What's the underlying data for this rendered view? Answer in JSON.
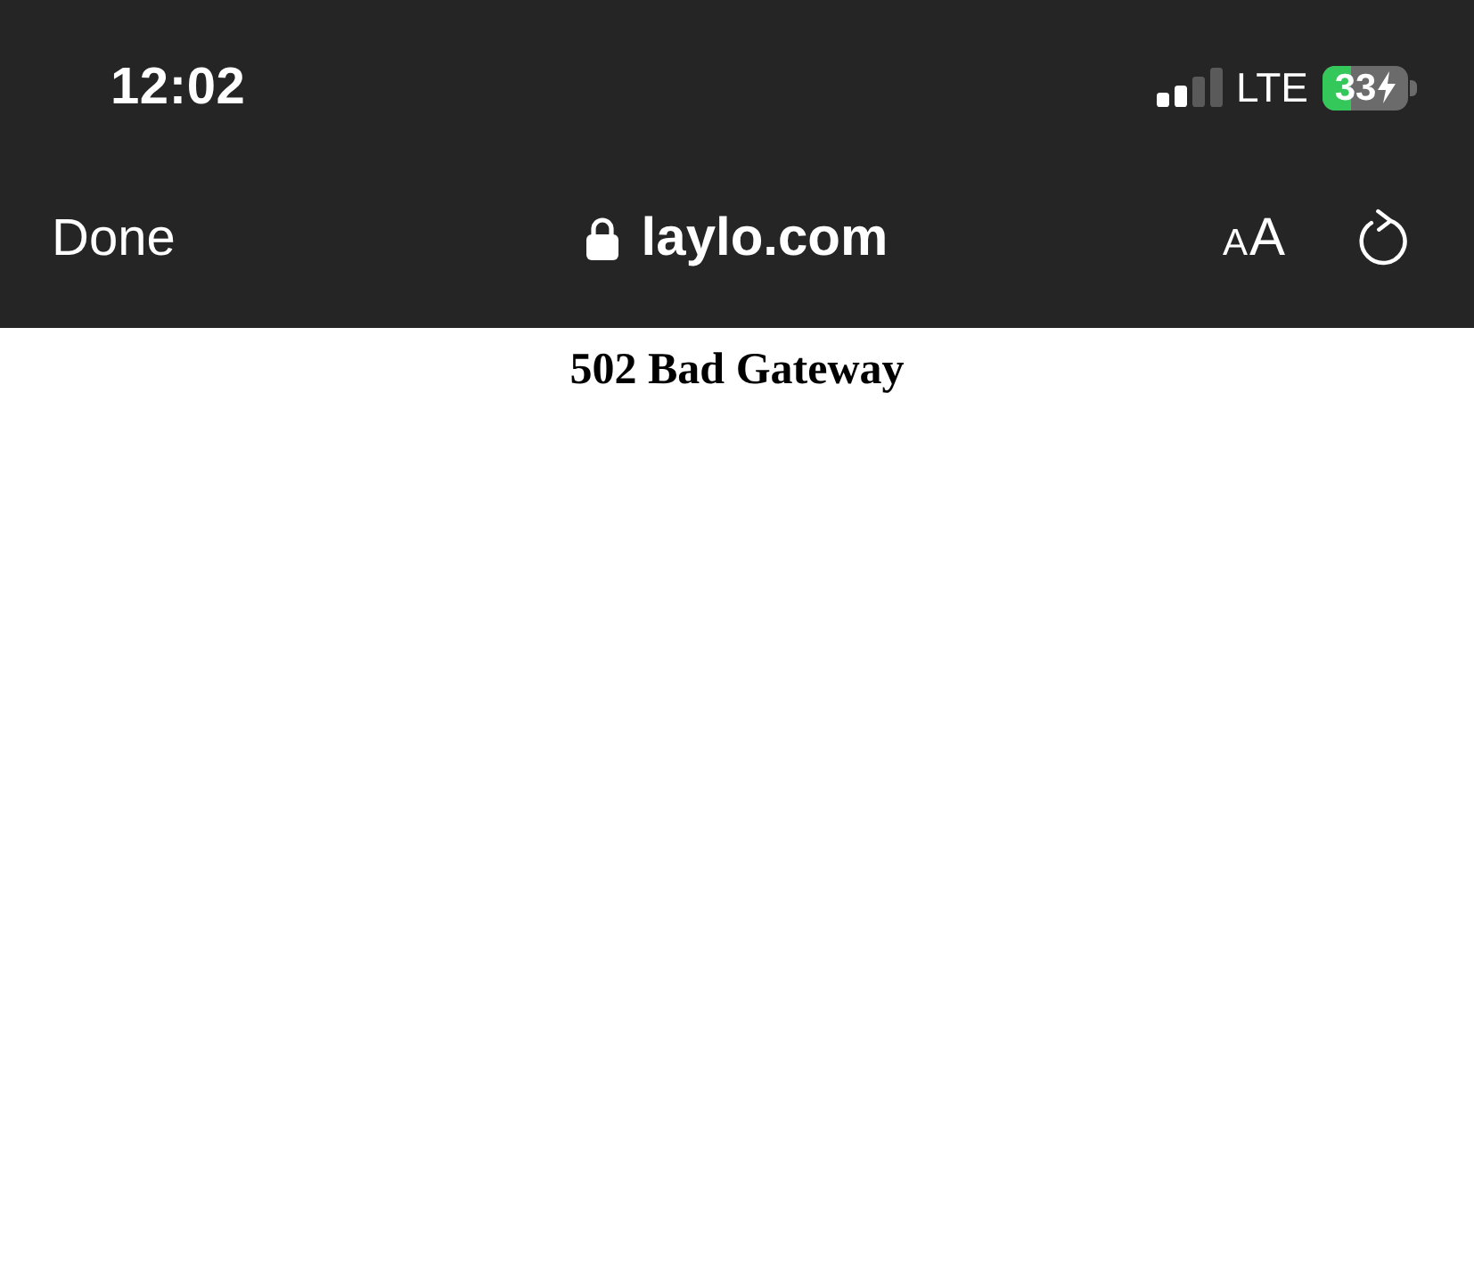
{
  "status_bar": {
    "time": "12:02",
    "network": "LTE",
    "battery": {
      "percent": "33",
      "charging": true
    }
  },
  "browser_bar": {
    "done_button": "Done",
    "address": {
      "secure": true,
      "domain": "laylo.com"
    },
    "text_size_button": [
      "A",
      "A"
    ]
  },
  "page": {
    "heading": "502 Bad Gateway"
  }
}
